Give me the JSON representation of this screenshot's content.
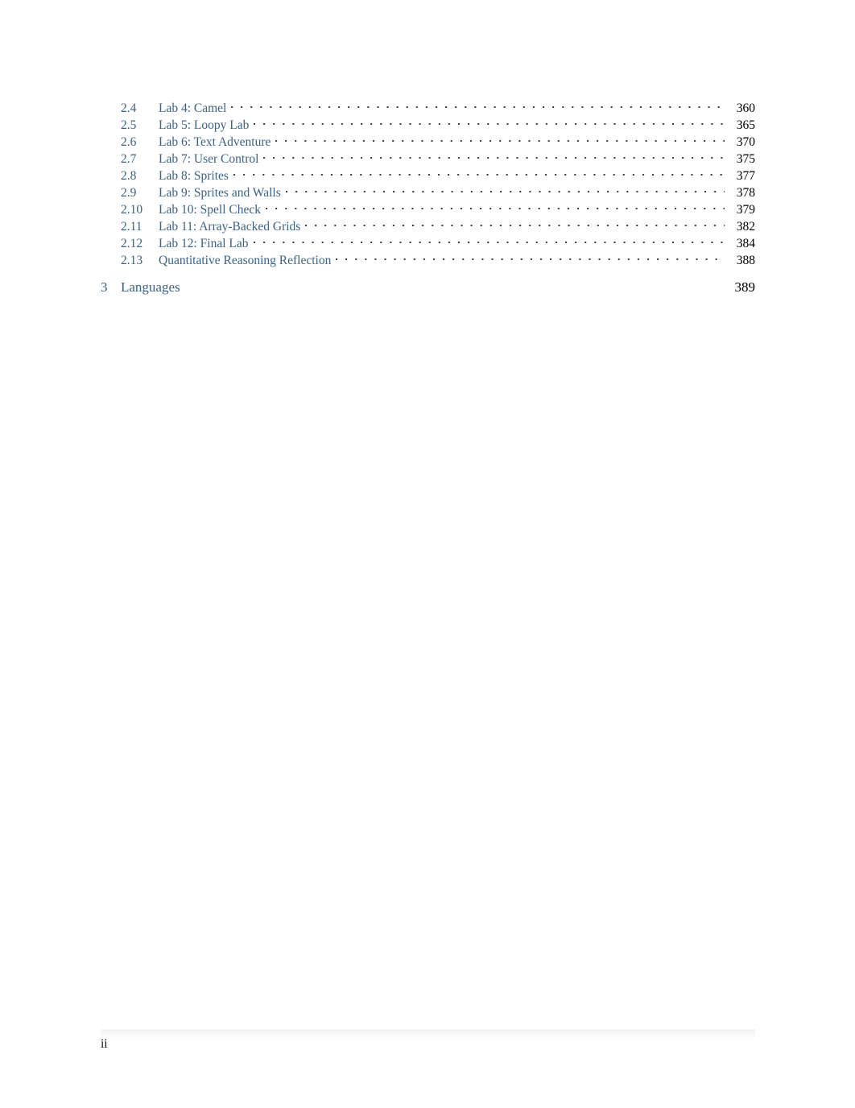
{
  "document": {
    "type": "table-of-contents",
    "folio": "ii",
    "entry_color": "#3c6283",
    "page_number_color": "#000000",
    "leader_color": "#3a3a3a",
    "background": "#ffffff"
  },
  "toc": {
    "sections": [
      {
        "number": "2.4",
        "title": "Lab 4: Camel",
        "page": "360"
      },
      {
        "number": "2.5",
        "title": "Lab 5: Loopy Lab",
        "page": "365"
      },
      {
        "number": "2.6",
        "title": "Lab 6: Text Adventure",
        "page": "370"
      },
      {
        "number": "2.7",
        "title": "Lab 7: User Control",
        "page": "375"
      },
      {
        "number": "2.8",
        "title": "Lab 8: Sprites",
        "page": "377"
      },
      {
        "number": "2.9",
        "title": "Lab 9: Sprites and Walls",
        "page": "378"
      },
      {
        "number": "2.10",
        "title": "Lab 10: Spell Check",
        "page": "379"
      },
      {
        "number": "2.11",
        "title": "Lab 11: Array-Backed Grids",
        "page": "382"
      },
      {
        "number": "2.12",
        "title": "Lab 12: Final Lab",
        "page": "384"
      },
      {
        "number": "2.13",
        "title": "Quantitative Reasoning Reflection",
        "page": "388"
      }
    ],
    "chapters": [
      {
        "number": "3",
        "title": "Languages",
        "page": "389"
      }
    ]
  }
}
